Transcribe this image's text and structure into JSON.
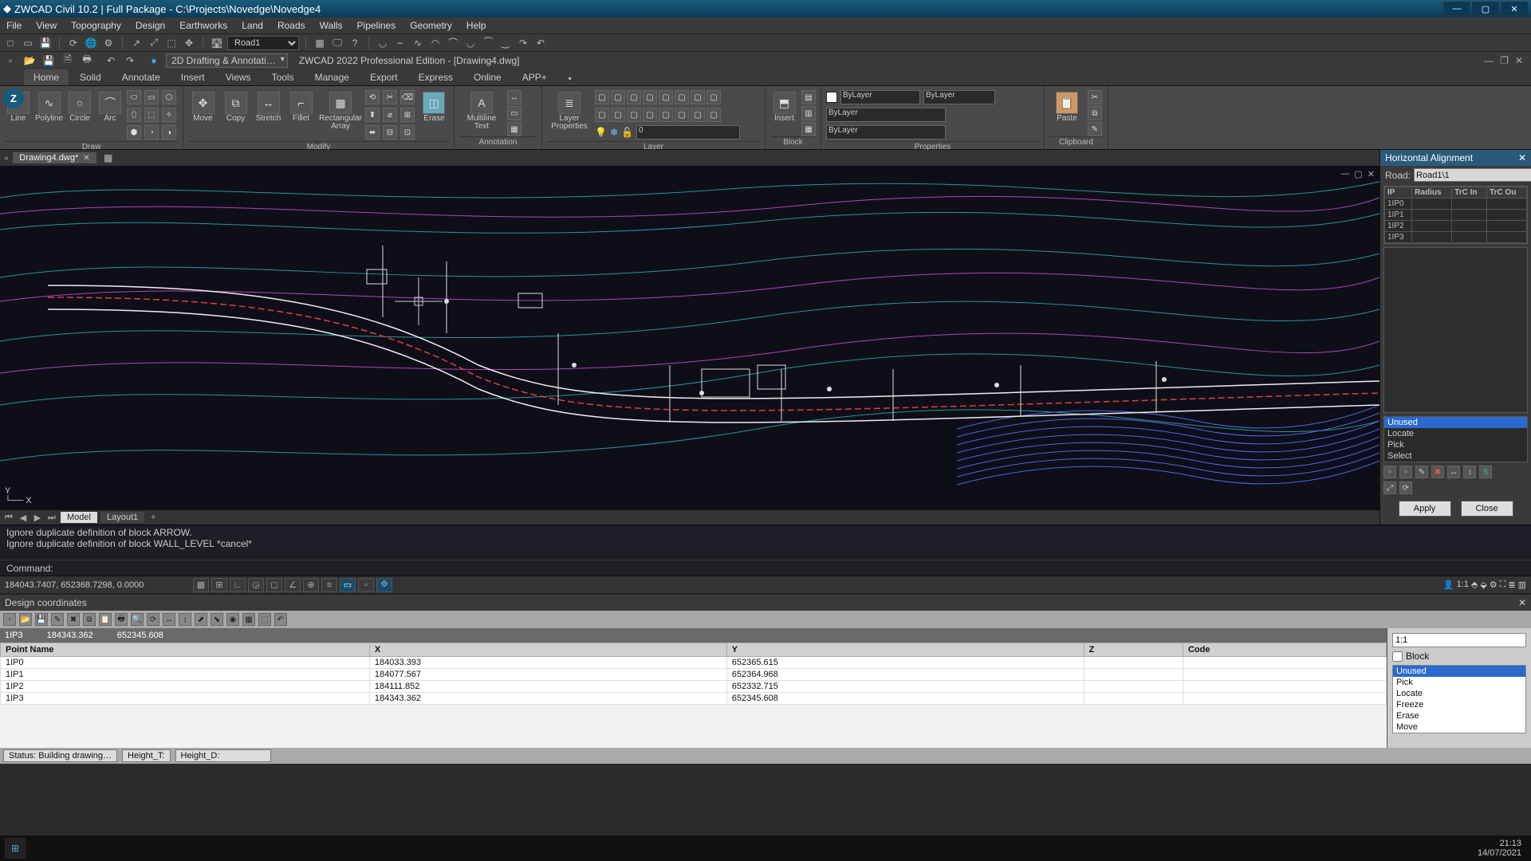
{
  "titlebar": {
    "app": "ZWCAD Civil 10.2",
    "pkg": "Full Package",
    "path": "C:\\Projects\\Novedge\\Novedge4"
  },
  "menubar": [
    "File",
    "View",
    "Topography",
    "Design",
    "Earthworks",
    "Land",
    "Roads",
    "Walls",
    "Pipelines",
    "Geometry",
    "Help"
  ],
  "quick1": {
    "road_selector": "Road1"
  },
  "docrow": {
    "workspace": "2D Drafting & Annotati…",
    "title": "ZWCAD 2022 Professional Edition - [Drawing4.dwg]"
  },
  "ribbon": {
    "tabs": [
      "Home",
      "Solid",
      "Annotate",
      "Insert",
      "Views",
      "Tools",
      "Manage",
      "Export",
      "Express",
      "Online",
      "APP+"
    ],
    "active": 0,
    "panels": {
      "draw": {
        "label": "Draw",
        "tools": [
          "Line",
          "Polyline",
          "Circle",
          "Arc"
        ]
      },
      "modify": {
        "label": "Modify",
        "tools": [
          "Move",
          "Copy",
          "Stretch",
          "Fillet",
          "Rectangular Array"
        ],
        "erase": "Erase"
      },
      "annotation": {
        "label": "Annotation",
        "tool": "Multiline Text"
      },
      "layer": {
        "label": "Layer",
        "tool": "Layer Properties",
        "current": "0"
      },
      "block": {
        "label": "Block",
        "tool": "Insert"
      },
      "properties": {
        "label": "Properties",
        "color": "ByLayer",
        "ltype": "ByLayer",
        "lweight": "ByLayer",
        "plot": "ByLayer"
      },
      "clipboard": {
        "label": "Clipboard",
        "tool": "Paste"
      }
    }
  },
  "document": {
    "tab": "Drawing4.dwg*",
    "layouts": [
      "Model",
      "Layout1"
    ],
    "active_layout": 0
  },
  "sidepanel": {
    "title": "Horizontal Alignment",
    "road_label": "Road:",
    "road_value": "Road1\\1",
    "cols": [
      "IP",
      "Radius",
      "TrC In",
      "TrC Ou"
    ],
    "rows": [
      "1IP0",
      "1IP1",
      "1IP2",
      "1IP3"
    ],
    "menu": [
      "Unused",
      "Locate",
      "Pick",
      "Select"
    ],
    "menu_sel": 0,
    "apply": "Apply",
    "close": "Close"
  },
  "cmdlog": [
    "Ignore duplicate definition of block ARROW.",
    "Ignore duplicate definition of block WALL_LEVEL *cancel*"
  ],
  "cmdprompt": "Command:",
  "status": {
    "coords": "184043.7407, 652368.7298, 0.0000",
    "iso": "1:1"
  },
  "design": {
    "title": "Design coordinates",
    "current": {
      "name": "1IP3",
      "x": "184343.362",
      "y": "652345.608"
    },
    "cols": [
      "Point Name",
      "X",
      "Y",
      "Z",
      "Code"
    ],
    "rows": [
      {
        "name": "1IP0",
        "x": "184033.393",
        "y": "652365.615",
        "z": "",
        "code": ""
      },
      {
        "name": "1IP1",
        "x": "184077.567",
        "y": "652364.968",
        "z": "",
        "code": ""
      },
      {
        "name": "1IP2",
        "x": "184111.852",
        "y": "652332.715",
        "z": "",
        "code": ""
      },
      {
        "name": "1IP3",
        "x": "184343.362",
        "y": "652345.608",
        "z": "",
        "code": ""
      }
    ],
    "scale": "1:1",
    "block_label": "Block",
    "opts": [
      "Unused",
      "Pick",
      "Locate",
      "Freeze",
      "Erase",
      "Move"
    ],
    "opts_sel": 0,
    "status_label": "Status: Building drawing…",
    "ht": "Height_T:",
    "hd": "Height_D:"
  },
  "clock": {
    "time": "21:13",
    "date": "14/07/2021"
  }
}
